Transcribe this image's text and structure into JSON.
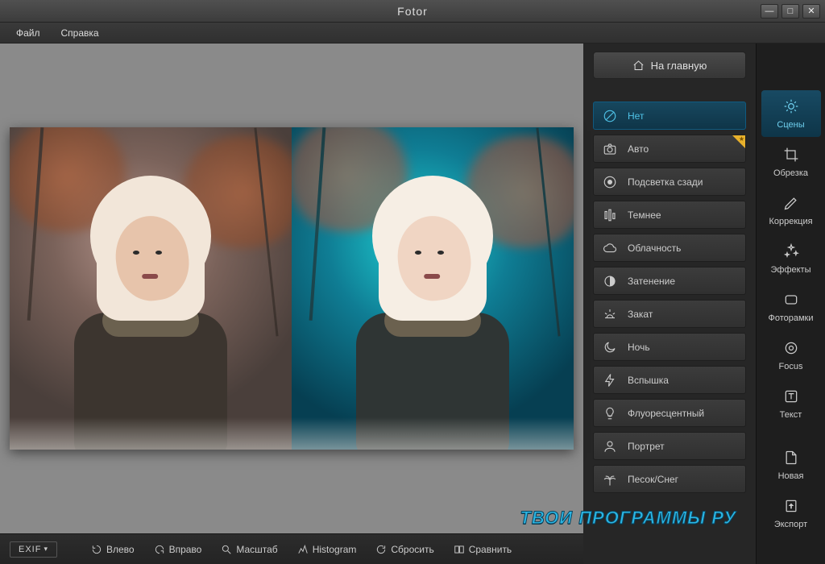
{
  "app": {
    "title": "Fotor"
  },
  "menubar": {
    "items": [
      "Файл",
      "Справка"
    ]
  },
  "window_controls": {
    "minimize": "—",
    "maximize": "□",
    "close": "✕"
  },
  "home_button": {
    "label": "На главную"
  },
  "rail": {
    "items": [
      {
        "id": "scenes",
        "label": "Сцены",
        "selected": true
      },
      {
        "id": "crop",
        "label": "Обрезка",
        "selected": false
      },
      {
        "id": "correct",
        "label": "Коррекция",
        "selected": false
      },
      {
        "id": "effects",
        "label": "Эффекты",
        "selected": false
      },
      {
        "id": "frames",
        "label": "Фоторамки",
        "selected": false
      },
      {
        "id": "focus",
        "label": "Focus",
        "selected": false
      },
      {
        "id": "text",
        "label": "Текст",
        "selected": false
      }
    ],
    "bottom": [
      {
        "id": "new",
        "label": "Новая"
      },
      {
        "id": "export",
        "label": "Экспорт"
      }
    ]
  },
  "scenes": {
    "items": [
      {
        "id": "none",
        "label": "Нет",
        "icon": "ban",
        "selected": true,
        "star": false
      },
      {
        "id": "auto",
        "label": "Авто",
        "icon": "camera",
        "selected": false,
        "star": true
      },
      {
        "id": "backlit",
        "label": "Подсветка сзади",
        "icon": "spot",
        "selected": false,
        "star": false
      },
      {
        "id": "darken",
        "label": "Темнее",
        "icon": "eq",
        "selected": false,
        "star": false
      },
      {
        "id": "cloudy",
        "label": "Облачность",
        "icon": "cloud",
        "selected": false,
        "star": false
      },
      {
        "id": "shade",
        "label": "Затенение",
        "icon": "shade",
        "selected": false,
        "star": false
      },
      {
        "id": "sunset",
        "label": "Закат",
        "icon": "sunset",
        "selected": false,
        "star": false
      },
      {
        "id": "night",
        "label": "Ночь",
        "icon": "moon",
        "selected": false,
        "star": false
      },
      {
        "id": "flash",
        "label": "Вспышка",
        "icon": "bolt",
        "selected": false,
        "star": false
      },
      {
        "id": "fluorescent",
        "label": "Флуоресцентный",
        "icon": "bulb",
        "selected": false,
        "star": false
      },
      {
        "id": "portrait",
        "label": "Портрет",
        "icon": "user",
        "selected": false,
        "star": false
      },
      {
        "id": "sand-snow",
        "label": "Песок/Снег",
        "icon": "palm",
        "selected": false,
        "star": false
      }
    ]
  },
  "toolbar": {
    "exif": "EXIF",
    "buttons": [
      {
        "id": "rot-left",
        "label": "Влево"
      },
      {
        "id": "rot-right",
        "label": "Вправо"
      },
      {
        "id": "zoom",
        "label": "Масштаб"
      },
      {
        "id": "histogram",
        "label": "Histogram"
      },
      {
        "id": "reset",
        "label": "Сбросить"
      },
      {
        "id": "compare",
        "label": "Сравнить"
      }
    ]
  },
  "watermark": "ТВОИ ПРОГРАММЫ РУ"
}
